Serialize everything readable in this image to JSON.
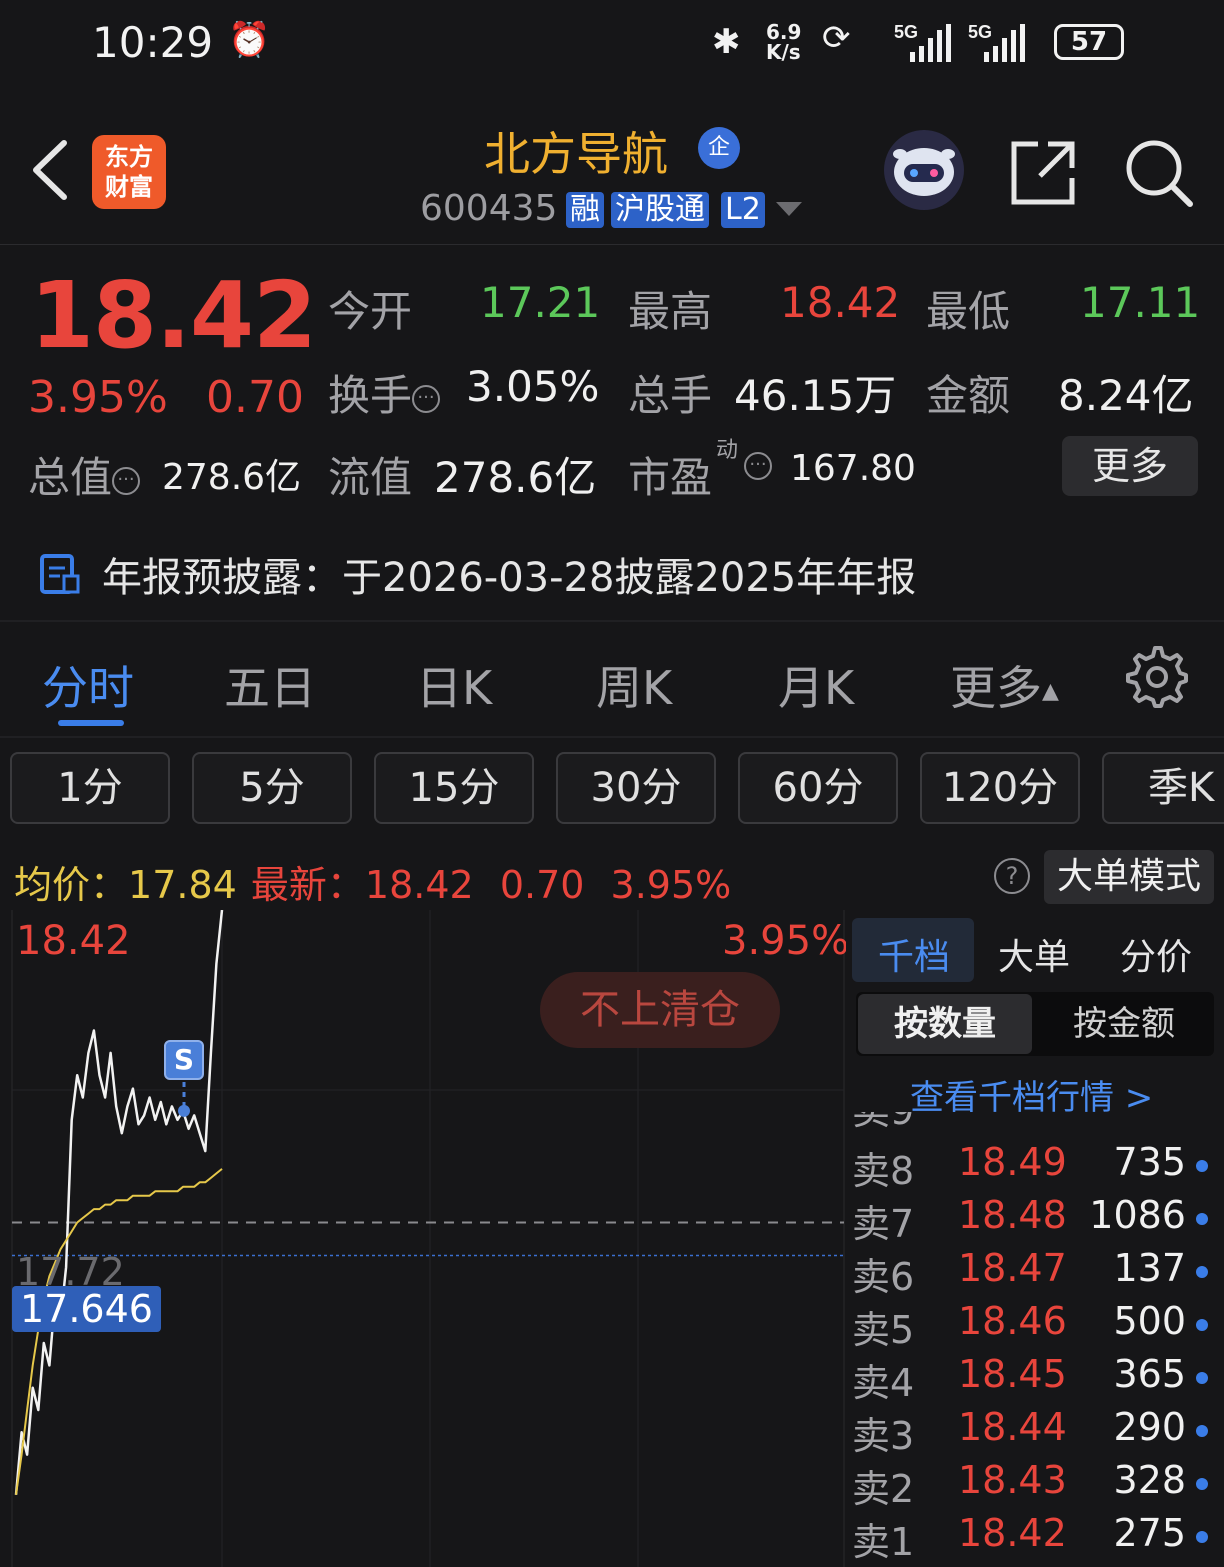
{
  "status_bar": {
    "time": "10:29",
    "net_speed": "6.9\nK/s",
    "battery": "57"
  },
  "header": {
    "logo_text_line1": "东方",
    "logo_text_line2": "财富",
    "stock_name": "北方导航",
    "ent_badge": "企",
    "stock_code": "600435",
    "tags": [
      "融",
      "沪股通",
      "L2"
    ]
  },
  "quote": {
    "price": "18.42",
    "change_pct": "3.95%",
    "change": "0.70",
    "open_label": "今开",
    "open": "17.21",
    "high_label": "最高",
    "high": "18.42",
    "low_label": "最低",
    "low": "17.11",
    "turnover_label": "换手",
    "turnover": "3.05%",
    "volume_label": "总手",
    "volume": "46.15万",
    "amount_label": "金额",
    "amount": "8.24亿",
    "mktcap_label": "总值",
    "mktcap": "278.6亿",
    "float_label": "流值",
    "float_cap": "278.6亿",
    "pe_label": "市盈",
    "pe_sup": "动",
    "pe": "167.80",
    "more_button": "更多"
  },
  "notice": {
    "text": "年报预披露：于2026-03-28披露2025年年报"
  },
  "chart_tabs": [
    "分时",
    "五日",
    "日K",
    "周K",
    "月K",
    "更多"
  ],
  "period_buttons": [
    "1分",
    "5分",
    "15分",
    "30分",
    "60分",
    "120分",
    "季K"
  ],
  "price_line": {
    "avg_label": "均价：",
    "avg": "17.84",
    "latest_label": "最新：",
    "latest": "18.42",
    "change": "0.70",
    "pct": "3.95%",
    "help": "?",
    "big_order_button": "大单模式"
  },
  "chart_labels": {
    "top_price": "18.42",
    "top_pct": "3.95%",
    "mid_price": "17.72",
    "cursor_price": "17.646",
    "marker": "S",
    "stamp": "不上清仓"
  },
  "chart_data": {
    "type": "line",
    "series": [
      {
        "values": [
          17.11,
          17.25,
          17.2,
          17.35,
          17.3,
          17.45,
          17.4,
          17.55,
          17.5,
          17.62,
          17.95,
          18.05,
          18.0,
          18.1,
          18.15,
          18.05,
          18.0,
          18.1,
          17.98,
          17.92,
          17.98,
          18.02,
          17.94,
          17.96,
          18.0,
          17.95,
          17.99,
          17.94,
          17.98,
          17.95,
          17.97,
          17.93,
          17.96,
          17.92,
          17.88,
          18.1,
          18.3,
          18.42
        ]
      },
      {
        "values": [
          17.11,
          17.2,
          17.3,
          17.4,
          17.48,
          17.55,
          17.6,
          17.63,
          17.66,
          17.68,
          17.7,
          17.72,
          17.73,
          17.74,
          17.75,
          17.75,
          17.76,
          17.76,
          17.77,
          17.77,
          17.77,
          17.78,
          17.78,
          17.78,
          17.78,
          17.79,
          17.79,
          17.79,
          17.79,
          17.79,
          17.8,
          17.8,
          17.8,
          17.81,
          17.81,
          17.82,
          17.83,
          17.84
        ]
      }
    ],
    "ylim": [
      17.02,
      18.42
    ],
    "reference_price": 17.72,
    "cursor_price": 17.646
  },
  "order_book": {
    "tabs": [
      "千档",
      "大单",
      "分价"
    ],
    "sub_tabs": [
      "按数量",
      "按金额"
    ],
    "link": "查看千档行情 >",
    "rows": [
      {
        "label": "卖8",
        "price": "18.49",
        "volume": "735"
      },
      {
        "label": "卖7",
        "price": "18.48",
        "volume": "1086"
      },
      {
        "label": "卖6",
        "price": "18.47",
        "volume": "137"
      },
      {
        "label": "卖5",
        "price": "18.46",
        "volume": "500"
      },
      {
        "label": "卖4",
        "price": "18.45",
        "volume": "365"
      },
      {
        "label": "卖3",
        "price": "18.44",
        "volume": "290"
      },
      {
        "label": "卖2",
        "price": "18.43",
        "volume": "328"
      },
      {
        "label": "卖1",
        "price": "18.42",
        "volume": "275"
      }
    ]
  }
}
